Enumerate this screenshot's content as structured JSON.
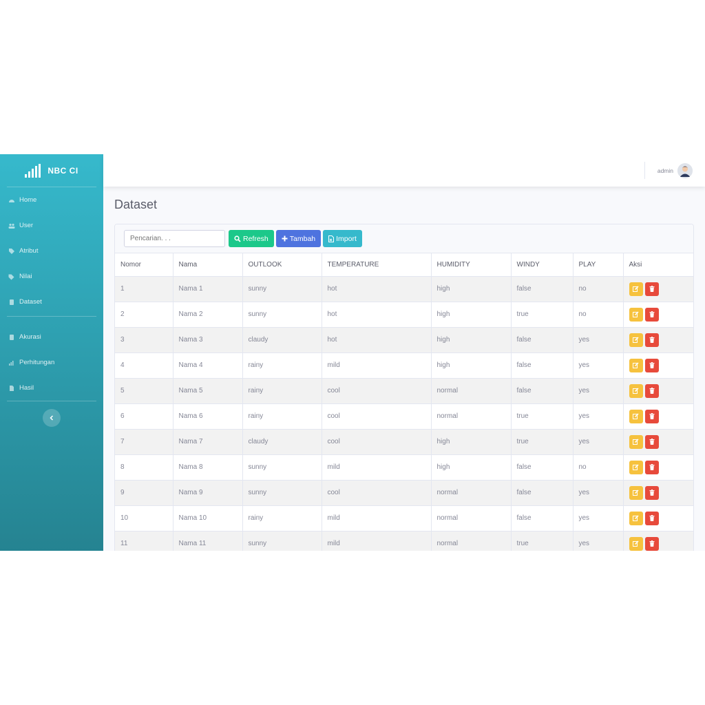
{
  "brand": {
    "name": "NBC CI"
  },
  "sidebar": {
    "items": [
      {
        "label": "Home",
        "icon": "dashboard-icon"
      },
      {
        "label": "User",
        "icon": "users-icon"
      },
      {
        "label": "Atribut",
        "icon": "tag-icon"
      },
      {
        "label": "Nilai",
        "icon": "tags-icon"
      },
      {
        "label": "Dataset",
        "icon": "database-icon"
      },
      {
        "label": "Akurasi",
        "icon": "calculator-icon"
      },
      {
        "label": "Perhitungan",
        "icon": "bar-chart-icon"
      },
      {
        "label": "Hasil",
        "icon": "file-icon"
      }
    ]
  },
  "topbar": {
    "user": "admin"
  },
  "page": {
    "title": "Dataset"
  },
  "toolbar": {
    "search_placeholder": "Pencarian. . .",
    "refresh_label": "Refresh",
    "add_label": "Tambah",
    "import_label": "Import"
  },
  "table": {
    "headers": [
      "Nomor",
      "Nama",
      "OUTLOOK",
      "TEMPERATURE",
      "HUMIDITY",
      "WINDY",
      "PLAY",
      "Aksi"
    ],
    "rows": [
      [
        "1",
        "Nama 1",
        "sunny",
        "hot",
        "high",
        "false",
        "no"
      ],
      [
        "2",
        "Nama 2",
        "sunny",
        "hot",
        "high",
        "true",
        "no"
      ],
      [
        "3",
        "Nama 3",
        "claudy",
        "hot",
        "high",
        "false",
        "yes"
      ],
      [
        "4",
        "Nama 4",
        "rainy",
        "mild",
        "high",
        "false",
        "yes"
      ],
      [
        "5",
        "Nama 5",
        "rainy",
        "cool",
        "normal",
        "false",
        "yes"
      ],
      [
        "6",
        "Nama 6",
        "rainy",
        "cool",
        "normal",
        "true",
        "yes"
      ],
      [
        "7",
        "Nama 7",
        "claudy",
        "cool",
        "high",
        "true",
        "yes"
      ],
      [
        "8",
        "Nama 8",
        "sunny",
        "mild",
        "high",
        "false",
        "no"
      ],
      [
        "9",
        "Nama 9",
        "sunny",
        "cool",
        "normal",
        "false",
        "yes"
      ],
      [
        "10",
        "Nama 10",
        "rainy",
        "mild",
        "normal",
        "false",
        "yes"
      ],
      [
        "11",
        "Nama 11",
        "sunny",
        "mild",
        "normal",
        "true",
        "yes"
      ]
    ]
  },
  "colors": {
    "sidebar_top": "#36b9cc",
    "sidebar_bottom": "#258391",
    "success": "#1cc88a",
    "primary": "#4e73df",
    "info": "#36b9cc",
    "warning": "#f6c23e",
    "danger": "#e74a3b"
  }
}
